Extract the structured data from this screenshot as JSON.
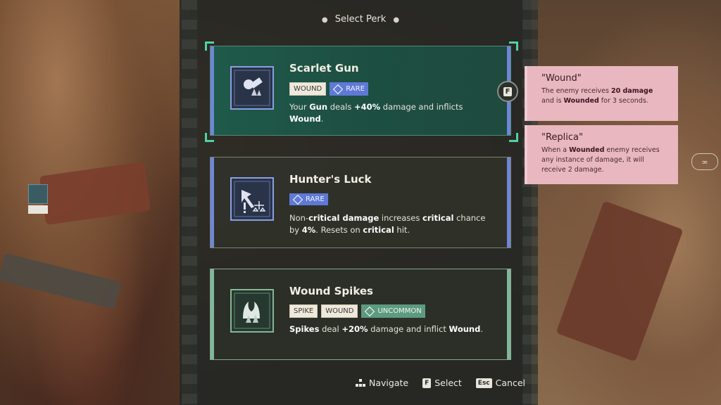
{
  "header": {
    "title": "Select Perk"
  },
  "cards": [
    {
      "title": "Scarlet Gun",
      "tags": [
        {
          "label": "WOUND",
          "kind": "plain"
        },
        {
          "label": "RARE",
          "kind": "rare"
        }
      ],
      "desc": [
        {
          "t": "Your ",
          "b": false
        },
        {
          "t": "Gun",
          "b": true
        },
        {
          "t": " deals ",
          "b": false
        },
        {
          "t": "+40%",
          "b": true
        },
        {
          "t": " damage and inflicts ",
          "b": false
        },
        {
          "t": "Wound",
          "b": true
        },
        {
          "t": ".",
          "b": false
        }
      ],
      "icon": "scarlet-gun-icon",
      "rarity_color": "#6f86d8",
      "selected": true
    },
    {
      "title": "Hunter's Luck",
      "tags": [
        {
          "label": "RARE",
          "kind": "rare"
        }
      ],
      "desc": [
        {
          "t": "Non-",
          "b": false
        },
        {
          "t": "critical damage",
          "b": true
        },
        {
          "t": " increases ",
          "b": false
        },
        {
          "t": "critical",
          "b": true
        },
        {
          "t": " chance by ",
          "b": false
        },
        {
          "t": "4%",
          "b": true
        },
        {
          "t": ". Resets on ",
          "b": false
        },
        {
          "t": "critical",
          "b": true
        },
        {
          "t": " hit.",
          "b": false
        }
      ],
      "icon": "hunters-luck-icon",
      "rarity_color": "#6f86d8",
      "selected": false
    },
    {
      "title": "Wound Spikes",
      "tags": [
        {
          "label": "SPIKE",
          "kind": "plain"
        },
        {
          "label": "WOUND",
          "kind": "plain"
        },
        {
          "label": "UNCOMMON",
          "kind": "uncommon"
        }
      ],
      "desc": [
        {
          "t": "Spikes",
          "b": true
        },
        {
          "t": " deal ",
          "b": false
        },
        {
          "t": "+20%",
          "b": true
        },
        {
          "t": " damage and inflict ",
          "b": false
        },
        {
          "t": "Wound",
          "b": true
        },
        {
          "t": ".",
          "b": false
        }
      ],
      "icon": "wound-spikes-icon",
      "rarity_color": "#7fb89a",
      "selected": false
    }
  ],
  "select_key": "F",
  "tooltips": [
    {
      "title": "\"Wound\"",
      "text": [
        {
          "t": "The enemy receives ",
          "b": false
        },
        {
          "t": "20 damage",
          "b": true
        },
        {
          "t": " and is ",
          "b": false
        },
        {
          "t": "Wounded",
          "b": true
        },
        {
          "t": " for 3 seconds.",
          "b": false
        }
      ]
    },
    {
      "title": "\"Replica\"",
      "text": [
        {
          "t": "When a ",
          "b": false
        },
        {
          "t": "Wounded",
          "b": true
        },
        {
          "t": " enemy receives any instance of damage, it will receive 2 damage.",
          "b": false
        }
      ]
    }
  ],
  "footer": {
    "navigate": {
      "label": "Navigate",
      "icon": "dpad-icon"
    },
    "select": {
      "key": "F",
      "label": "Select"
    },
    "cancel": {
      "key": "Esc",
      "label": "Cancel"
    }
  },
  "colors": {
    "rare": "#5f79d6",
    "uncommon": "#5d9a7f",
    "tooltip_bg": "#e8b7bf",
    "selected_card": "#1f5a4a"
  }
}
